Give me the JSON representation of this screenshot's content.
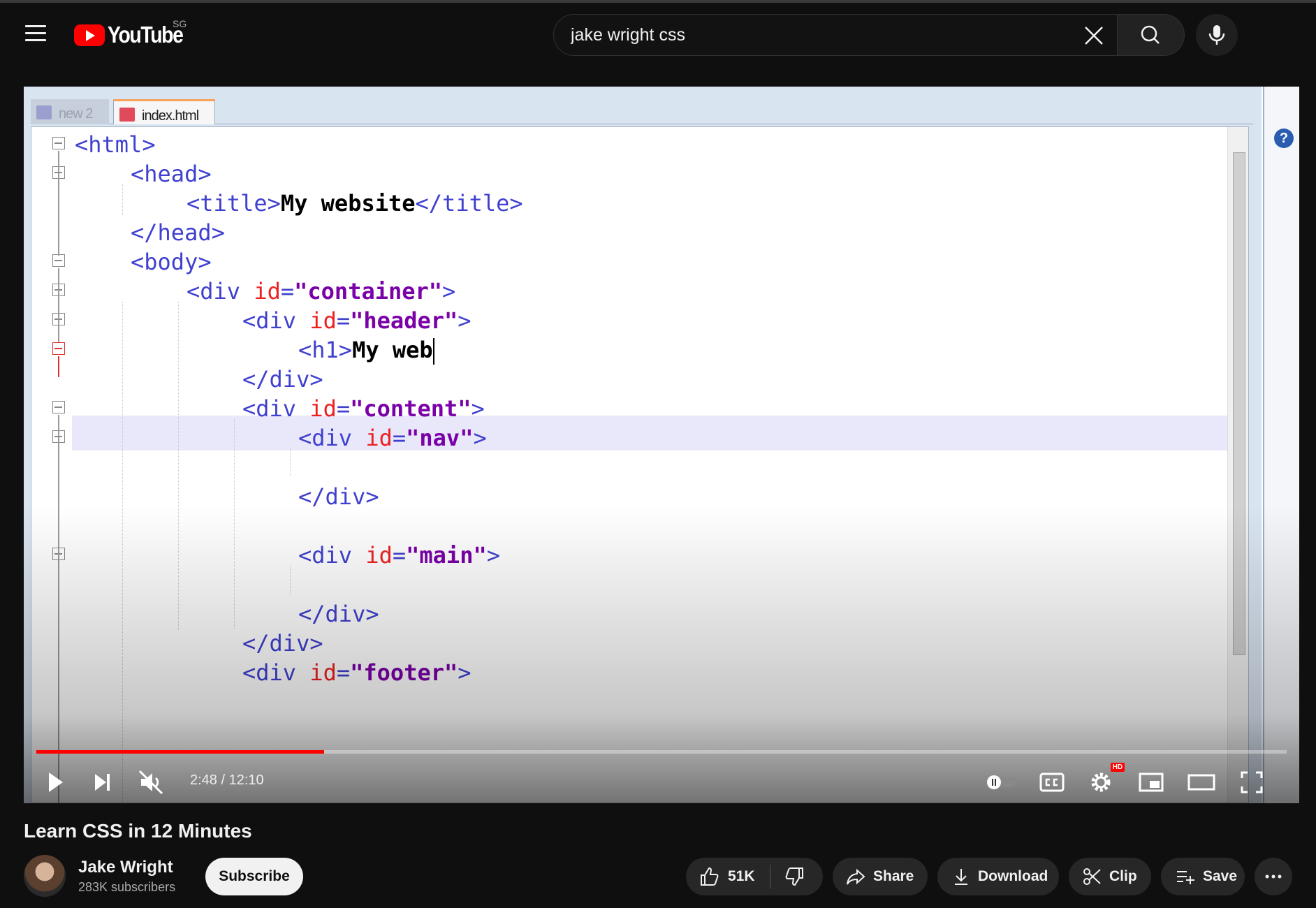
{
  "masthead": {
    "logo_text": "YouTube",
    "country_code": "SG",
    "search_value": "jake wright css"
  },
  "editor": {
    "tabs": [
      {
        "label": "new  2"
      },
      {
        "label": "index.html"
      }
    ],
    "help_glyph": "?"
  },
  "player": {
    "current_time": "2:48",
    "time_separator": " / ",
    "duration": "12:10",
    "progress_fraction": 0.23,
    "accent_color": "#ff0000",
    "hd_badge": "HD"
  },
  "video": {
    "title": "Learn CSS in 12 Minutes",
    "channel_name": "Jake Wright",
    "subscribers": "283K subscribers",
    "subscribe_label": "Subscribe",
    "likes": "51K",
    "share_label": "Share",
    "download_label": "Download",
    "clip_label": "Clip",
    "save_label": "Save"
  }
}
